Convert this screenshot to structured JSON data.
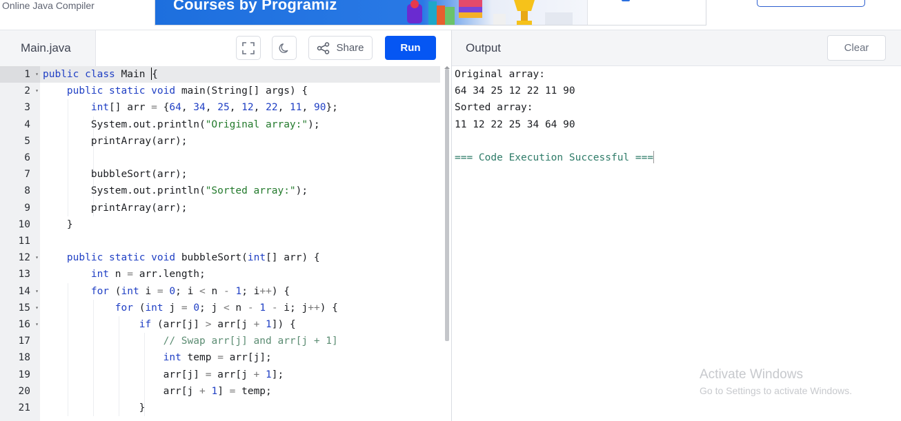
{
  "site": {
    "title": "Online Java Compiler",
    "ad_text": "Courses by Programiz"
  },
  "toolbar": {
    "file_tab": "Main.java",
    "share_label": "Share",
    "run_label": "Run",
    "output_title": "Output",
    "clear_label": "Clear"
  },
  "editor": {
    "active_line": 1,
    "lines": [
      "public class Main {",
      "    public static void main(String[] args) {",
      "        int[] arr = {64, 34, 25, 12, 22, 11, 90};",
      "        System.out.println(\"Original array:\");",
      "        printArray(arr);",
      "",
      "        bubbleSort(arr);",
      "        System.out.println(\"Sorted array:\");",
      "        printArray(arr);",
      "    }",
      "",
      "    public static void bubbleSort(int[] arr) {",
      "        int n = arr.length;",
      "        for (int i = 0; i < n - 1; i++) {",
      "            for (int j = 0; j < n - 1 - i; j++) {",
      "                if (arr[j] > arr[j + 1]) {",
      "                    // Swap arr[j] and arr[j + 1]",
      "                    int temp = arr[j];",
      "                    arr[j] = arr[j + 1];",
      "                    arr[j + 1] = temp;",
      "                }"
    ],
    "fold_lines": [
      1,
      2,
      12,
      14,
      15,
      16
    ]
  },
  "output": {
    "lines": [
      "Original array:",
      "64 34 25 12 22 11 90",
      "Sorted array:",
      "11 12 22 25 34 64 90",
      "",
      "=== Code Execution Successful ==="
    ]
  },
  "watermark": {
    "line1": "Activate Windows",
    "line2": "Go to Settings to activate Windows."
  },
  "colors": {
    "run_button": "#0556f3",
    "keyword": "#1f3fc4",
    "string": "#237a2c",
    "comment": "#5b8c72",
    "success": "#2e7b68"
  },
  "icons": [
    "fullscreen-icon",
    "moon-icon",
    "share-icon",
    "fold-arrow-icon"
  ]
}
